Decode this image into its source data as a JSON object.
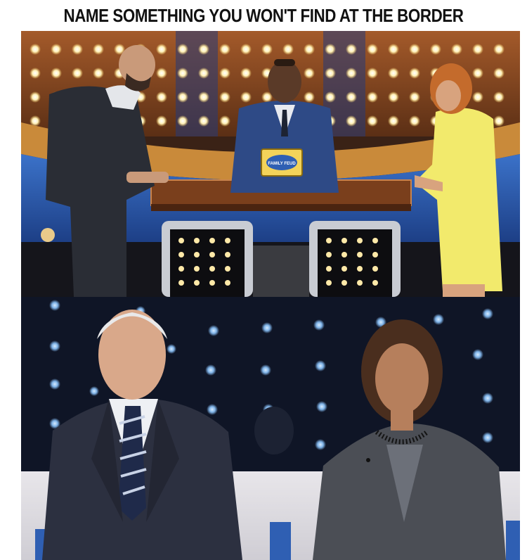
{
  "caption": {
    "text": "NAME SOMETHING YOU WON'T FIND AT THE BORDER"
  },
  "panels": {
    "top": {
      "scene": "game-show-stage",
      "podium_sign": "FAMILY FEUD"
    },
    "bottom": {
      "scene": "two-people-on-stage"
    }
  },
  "colors": {
    "caption_text": "#111111",
    "background": "#ffffff",
    "stage_wood": "#8a4a22",
    "stage_blue": "#2f5fb3",
    "bulb_light": "#fff4c8",
    "yellow_dress": "#f2ea6c",
    "dark_suit": "#2a2d35",
    "grey_suit": "#4b4e55",
    "blue_dots": "#7fb3e8"
  }
}
